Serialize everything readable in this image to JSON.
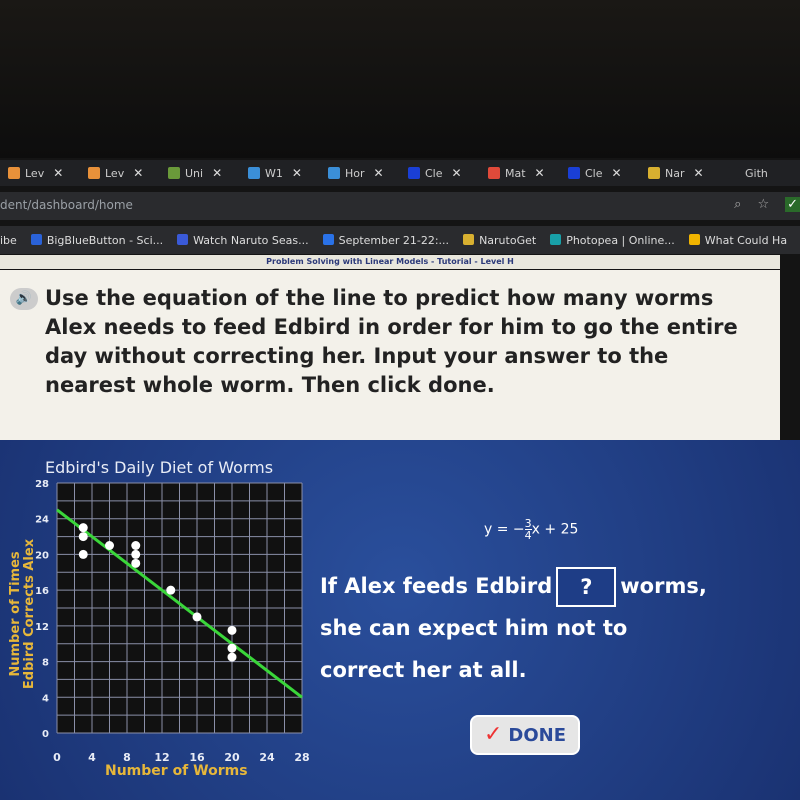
{
  "browser": {
    "tabs": [
      {
        "label": "Lev",
        "color": "#e8913a"
      },
      {
        "label": "Lev",
        "color": "#e8913a"
      },
      {
        "label": "Uni",
        "color": "#6a9a3a"
      },
      {
        "label": "W1",
        "color": "#3b8fd8"
      },
      {
        "label": "Hor",
        "color": "#3b8fd8"
      },
      {
        "label": "Cle",
        "color": "#1a3fd6"
      },
      {
        "label": "Mat",
        "color": "#e04a3a"
      },
      {
        "label": "Cle",
        "color": "#1a3fd6"
      },
      {
        "label": "Nar",
        "color": "#d8b030"
      },
      {
        "label": "Gith",
        "color": "#202124"
      }
    ],
    "url": "dent/dashboard/home",
    "bookmarks": [
      {
        "label": "ibe",
        "color": "#2a2b2e"
      },
      {
        "label": "BigBlueButton - Sci...",
        "color": "#2a62d8"
      },
      {
        "label": "Watch Naruto Seas...",
        "color": "#3a5ad8"
      },
      {
        "label": "September 21-22:...",
        "color": "#2a72e8"
      },
      {
        "label": "NarutoGet",
        "color": "#d8b030"
      },
      {
        "label": "Photopea | Online...",
        "color": "#18a0a8"
      },
      {
        "label": "What Could Ha",
        "color": "#f0b400"
      }
    ]
  },
  "lesson": {
    "header": "Problem Solving with Linear Models - Tutorial - Level H",
    "question": "Use the equation of the line to predict how many worms Alex needs to feed Edbird in order for him to go the entire day without correcting her. Input your answer to the nearest whole worm. Then click done.",
    "equation": {
      "prefix": "y = −",
      "num": "3",
      "den": "4",
      "suffix": "x + 25"
    },
    "statement_1": "If Alex feeds Edbird",
    "answer_value": "?",
    "statement_2": "worms,",
    "statement_3": "she can expect him not to correct her at all.",
    "done_label": "DONE"
  },
  "chart_data": {
    "type": "scatter",
    "title": "Edbird's Daily Diet of Worms",
    "xlabel": "Number of Worms",
    "ylabel": "Number of Times Edbird Corrects Alex",
    "xlim": [
      0,
      28
    ],
    "ylim": [
      0,
      28
    ],
    "xticks": [
      0,
      4,
      8,
      12,
      16,
      20,
      24,
      28
    ],
    "yticks": [
      0,
      4,
      8,
      12,
      16,
      20,
      24,
      28
    ],
    "grid": true,
    "points": [
      [
        3,
        23
      ],
      [
        3,
        22
      ],
      [
        3,
        20
      ],
      [
        6,
        21
      ],
      [
        9,
        21
      ],
      [
        9,
        20
      ],
      [
        9,
        19
      ],
      [
        13,
        16
      ],
      [
        16,
        13
      ],
      [
        20,
        11.5
      ],
      [
        20,
        9.5
      ],
      [
        20,
        8.5
      ]
    ],
    "line": {
      "slope": -0.75,
      "intercept": 25,
      "color": "#3ad63a"
    },
    "point_color": "#ffffff"
  }
}
